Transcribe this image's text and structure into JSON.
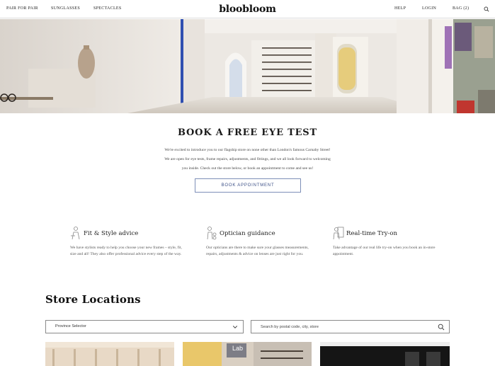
{
  "header": {
    "nav_left": [
      "PAIR FOR PAIR",
      "SUNGLASSES",
      "SPECTACLES"
    ],
    "logo": "bloobloom",
    "help": "HELP",
    "login": "LOGIN",
    "bag": "BAG (2)"
  },
  "book": {
    "title": "BOOK A FREE EYE TEST",
    "line1": "We're excited to introduce you to our flagship store on none other than London's famous Carnaby Street!",
    "line2": "We are open for eye tests, frame repairs, adjustments, and fittings, and we all look forward to welcoming",
    "line3": "you inside. Check out the store below, or book an appointment to come and see us!",
    "button": "BOOK APPOINTMENT"
  },
  "features": [
    {
      "title": "Fit & Style advice",
      "text": "We have stylists ready to help you choose your new frames – style, fit, size and all! They also offer professional advice every step of the way.",
      "icon": "stylist-icon"
    },
    {
      "title": "Optician guidance",
      "text": "Our opticians are there to make sure your glasses measurements, repairs, adjustments & advice on lenses are just right for you.",
      "icon": "optician-icon"
    },
    {
      "title": "Real-time Try-on",
      "text": "Take advantage of our real life try-on when you book an in-store appointment.",
      "icon": "try-on-icon"
    }
  ],
  "stores": {
    "title": "Store Locations",
    "province_selected": "Province Selector",
    "search_placeholder": "Search by postal code, city, store",
    "lab_sign": "Lab"
  },
  "colors": {
    "accent": "#3b4f86",
    "border": "#8a8a8a"
  }
}
